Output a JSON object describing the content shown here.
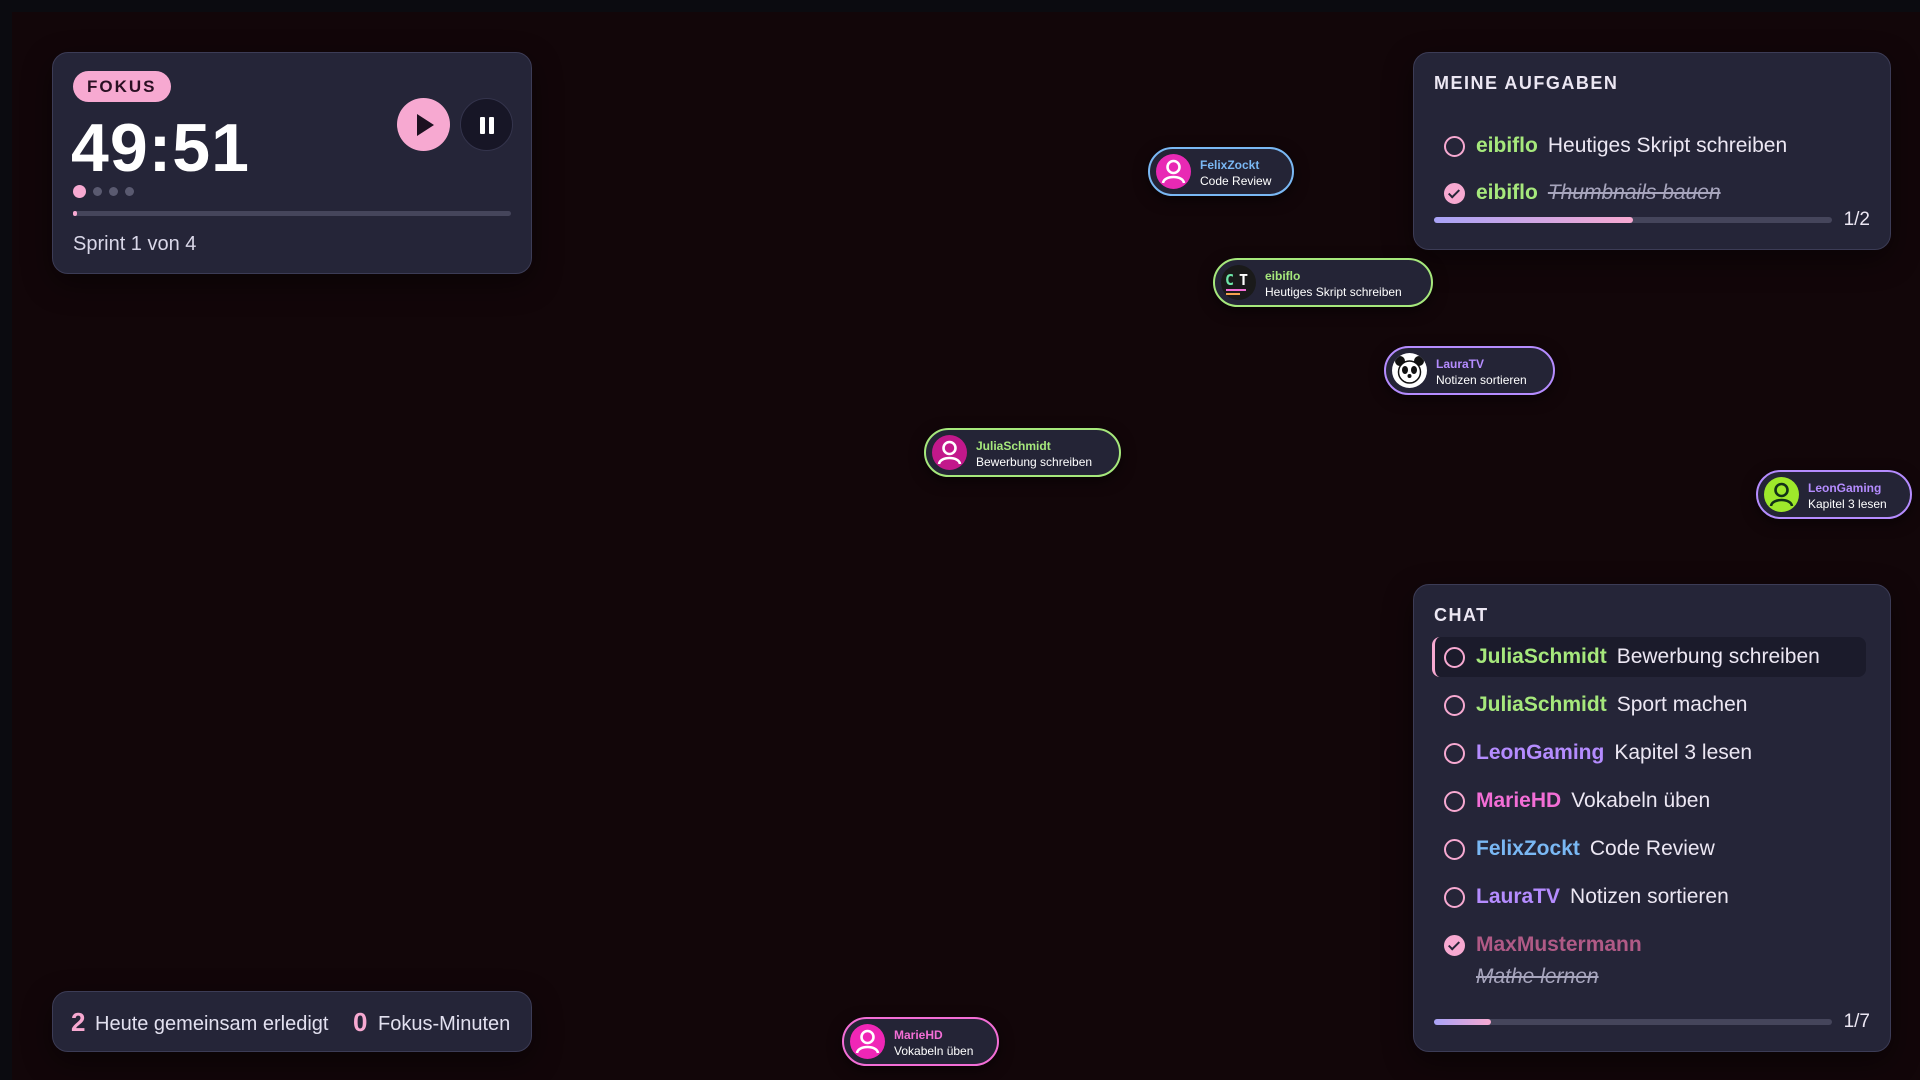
{
  "colors": {
    "background": "#120609",
    "panel": "#252538",
    "accent_pink": "#f7a9d1",
    "user_green": "#a6e87c",
    "user_purple": "#b58cff",
    "user_magenta": "#f36ed6",
    "user_blue": "#7ab8f4",
    "user_muted": "#b05a86"
  },
  "timer": {
    "mode_badge": "FOKUS",
    "time": "49:51",
    "sprint_label": "Sprint 1 von 4",
    "sprint_current": 1,
    "sprint_total": 4,
    "progress": 0.01,
    "play_icon": "play-icon",
    "pause_icon": "pause-icon"
  },
  "stats": {
    "done_count": "2",
    "done_label": "Heute gemeinsam erledigt",
    "focus_count": "0",
    "focus_label": "Fokus-Minuten"
  },
  "my_tasks": {
    "title": "MEINE AUFGABEN",
    "items": [
      {
        "user": "eibiflo",
        "task": "Heutiges Skript schreiben",
        "done": false
      },
      {
        "user": "eibiflo",
        "task": "Thumbnails bauen",
        "done": true
      }
    ],
    "count": "1/2",
    "progress": 0.5
  },
  "chat": {
    "title": "CHAT",
    "items": [
      {
        "user": "JuliaSchmidt",
        "task": "Bewerbung schreiben",
        "done": false
      },
      {
        "user": "JuliaSchmidt",
        "task": "Sport machen",
        "done": false
      },
      {
        "user": "LeonGaming",
        "task": "Kapitel 3 lesen",
        "done": false
      },
      {
        "user": "MarieHD",
        "task": "Vokabeln üben",
        "done": false
      },
      {
        "user": "FelixZockt",
        "task": "Code Review",
        "done": false
      },
      {
        "user": "LauraTV",
        "task": "Notizen sortieren",
        "done": false
      },
      {
        "user": "MaxMustermann",
        "task": "Mathe lernen",
        "done": true
      }
    ],
    "count": "1/7",
    "progress": 0.143
  },
  "bubbles": [
    {
      "user": "FelixZockt",
      "task": "Code Review",
      "avatar": "user-icon"
    },
    {
      "user": "eibiflo",
      "task": "Heutiges Skript schreiben",
      "avatar": "ct-logo-icon"
    },
    {
      "user": "LauraTV",
      "task": "Notizen sortieren",
      "avatar": "panda-icon"
    },
    {
      "user": "JuliaSchmidt",
      "task": "Bewerbung schreiben",
      "avatar": "user-icon"
    },
    {
      "user": "LeonGaming",
      "task": "Kapitel 3 lesen",
      "avatar": "user-icon"
    },
    {
      "user": "MarieHD",
      "task": "Vokabeln üben",
      "avatar": "user-icon"
    }
  ]
}
